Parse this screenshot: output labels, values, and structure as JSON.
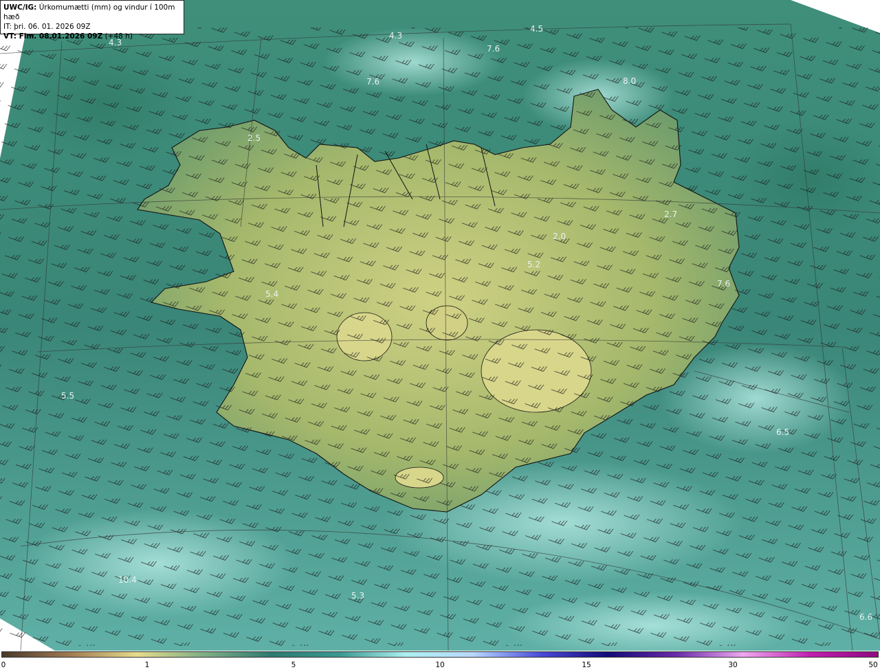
{
  "header": {
    "model_label": "UWC/IG:",
    "product": "Úrkomumætti (mm) og vindur í 100m hæð",
    "it_label": "IT:",
    "init_time": "þri. 06. 01. 2026 09Z",
    "vt_label": "VT: Fim. 08.01.2026 09Z",
    "lead_time": "(+48 h)"
  },
  "map_labels": [
    {
      "text": "4.3"
    },
    {
      "text": "4.3"
    },
    {
      "text": "4.5"
    },
    {
      "text": "7.6"
    },
    {
      "text": "7.6"
    },
    {
      "text": "8.0"
    },
    {
      "text": "2.5"
    },
    {
      "text": "2.7"
    },
    {
      "text": "2.0"
    },
    {
      "text": "5.2"
    },
    {
      "text": "5.4"
    },
    {
      "text": "7.6"
    },
    {
      "text": "5.5"
    },
    {
      "text": "6.5"
    },
    {
      "text": "5.3"
    },
    {
      "text": "6.6"
    },
    {
      "text": "10.4"
    }
  ],
  "colorbar": {
    "ticks": [
      "0",
      "1",
      "5",
      "10",
      "15",
      "30",
      "50"
    ],
    "colors": [
      "#4a3a2a",
      "#a07a50",
      "#e6dc8c",
      "#7fae86",
      "#2f7a70",
      "#3a9890",
      "#aef0f0",
      "#b8d8ff",
      "#4a4ad8",
      "#140a78",
      "#6a2aa8",
      "#f0a8f0",
      "#c020b0",
      "#900a80"
    ]
  },
  "colors": {
    "sea": "#3a8c80",
    "land_high": "#d9d48a",
    "coastline": "#111111"
  }
}
